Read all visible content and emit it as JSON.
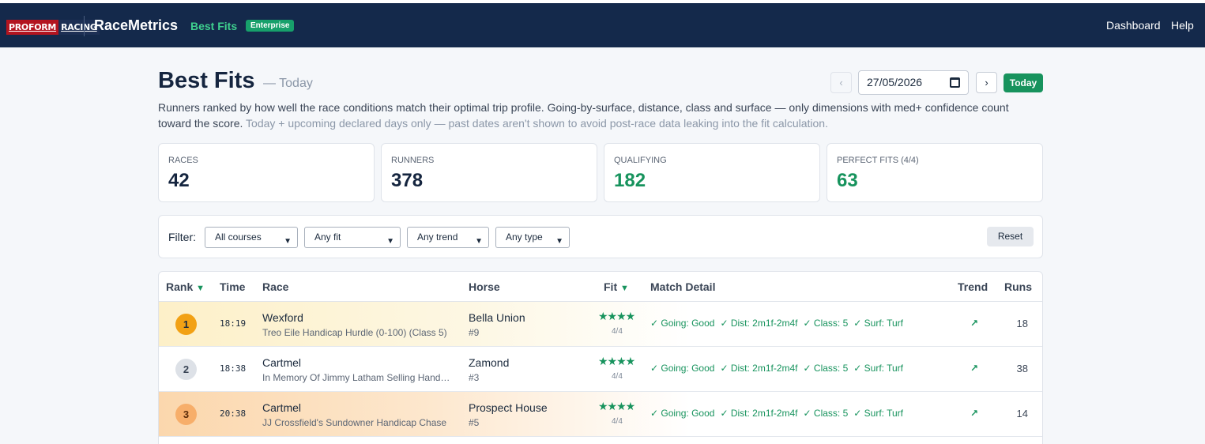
{
  "navbar": {
    "logo_part1": "PROFORM",
    "logo_part2": "RACING",
    "brand": "RaceMetrics",
    "section": "Best Fits",
    "badge": "Enterprise",
    "links": [
      "Dashboard",
      "Help"
    ]
  },
  "header": {
    "title": "Best Fits",
    "subtitle": "— Today",
    "description": "Runners ranked by how well the race conditions match their optimal trip profile. Going-by-surface, distance, class and surface — only dimensions with med+ confidence count toward the score.",
    "description_muted": "Today + upcoming declared days only — past dates aren't shown to avoid post-race data leaking into the fit calculation."
  },
  "date_nav": {
    "prev": "‹",
    "date": "27/05/2026",
    "next": "›",
    "today": "Today"
  },
  "stats": [
    {
      "label": "RACES",
      "value": "42",
      "accent": false
    },
    {
      "label": "RUNNERS",
      "value": "378",
      "accent": false
    },
    {
      "label": "QUALIFYING",
      "value": "182",
      "accent": true
    },
    {
      "label": "PERFECT FITS (4/4)",
      "value": "63",
      "accent": true
    }
  ],
  "filters": {
    "label": "Filter:",
    "selects": [
      "All courses",
      "Any fit",
      "Any trend",
      "Any type"
    ],
    "reset": "Reset"
  },
  "table": {
    "headers": {
      "rank": "Rank",
      "time": "Time",
      "race": "Race",
      "horse": "Horse",
      "fit": "Fit",
      "detail": "Match Detail",
      "trend": "Trend",
      "runs": "Runs"
    },
    "sort_icon": "▼",
    "rows": [
      {
        "rank": "1",
        "time": "18:19",
        "course": "Wexford",
        "race": "Treo Eile Handicap Hurdle (0-100) (Class 5)",
        "horse": "Bella Union",
        "cloth": "#9",
        "stars": "★★★★",
        "score": "4/4",
        "detail": [
          "✓ Going: Good",
          "✓ Dist: 2m1f-2m4f",
          "✓ Class: 5",
          "✓ Surf: Turf"
        ],
        "trend": "↗",
        "runs": "18"
      },
      {
        "rank": "2",
        "time": "18:38",
        "course": "Cartmel",
        "race": "In Memory Of Jimmy Latham Selling Handicap Hurdle",
        "horse": "Zamond",
        "cloth": "#3",
        "stars": "★★★★",
        "score": "4/4",
        "detail": [
          "✓ Going: Good",
          "✓ Dist: 2m1f-2m4f",
          "✓ Class: 5",
          "✓ Surf: Turf"
        ],
        "trend": "↗",
        "runs": "38"
      },
      {
        "rank": "3",
        "time": "20:38",
        "course": "Cartmel",
        "race": "JJ Crossfield's Sundowner Handicap Chase",
        "horse": "Prospect House",
        "cloth": "#5",
        "stars": "★★★★",
        "score": "4/4",
        "detail": [
          "✓ Going: Good",
          "✓ Dist: 2m1f-2m4f",
          "✓ Class: 5",
          "✓ Surf: Turf"
        ],
        "trend": "↗",
        "runs": "14"
      }
    ]
  }
}
